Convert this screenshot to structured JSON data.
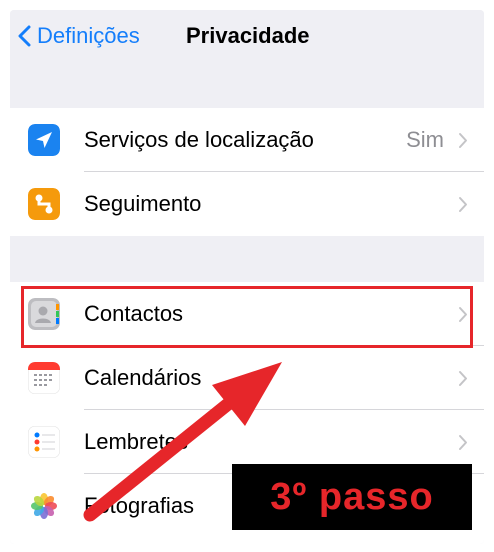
{
  "navbar": {
    "back_label": "Definições",
    "title": "Privacidade"
  },
  "groups": [
    {
      "rows": [
        {
          "label": "Serviços de localização",
          "value": "Sim",
          "icon": "location-arrow-icon",
          "icon_color": "#1a83f0"
        },
        {
          "label": "Seguimento",
          "value": "",
          "icon": "tracking-icon",
          "icon_color": "#f59a0c"
        }
      ]
    },
    {
      "rows": [
        {
          "label": "Contactos",
          "icon": "contacts-icon",
          "icon_color": "#a9a9ae"
        },
        {
          "label": "Calendários",
          "icon": "calendar-icon",
          "icon_color": "#ff3b30"
        },
        {
          "label": "Lembretes",
          "icon": "reminders-icon",
          "icon_color": "#ffffff"
        },
        {
          "label": "Fotografias",
          "icon": "photos-icon",
          "icon_color": "#ffffff"
        }
      ]
    }
  ],
  "annotation": {
    "step_text": "3º passo",
    "color": "#e6262a"
  },
  "colors": {
    "accent": "#147efb",
    "background": "#efeff4",
    "separator": "#d6d6da",
    "secondary_text": "#8e8e93"
  }
}
